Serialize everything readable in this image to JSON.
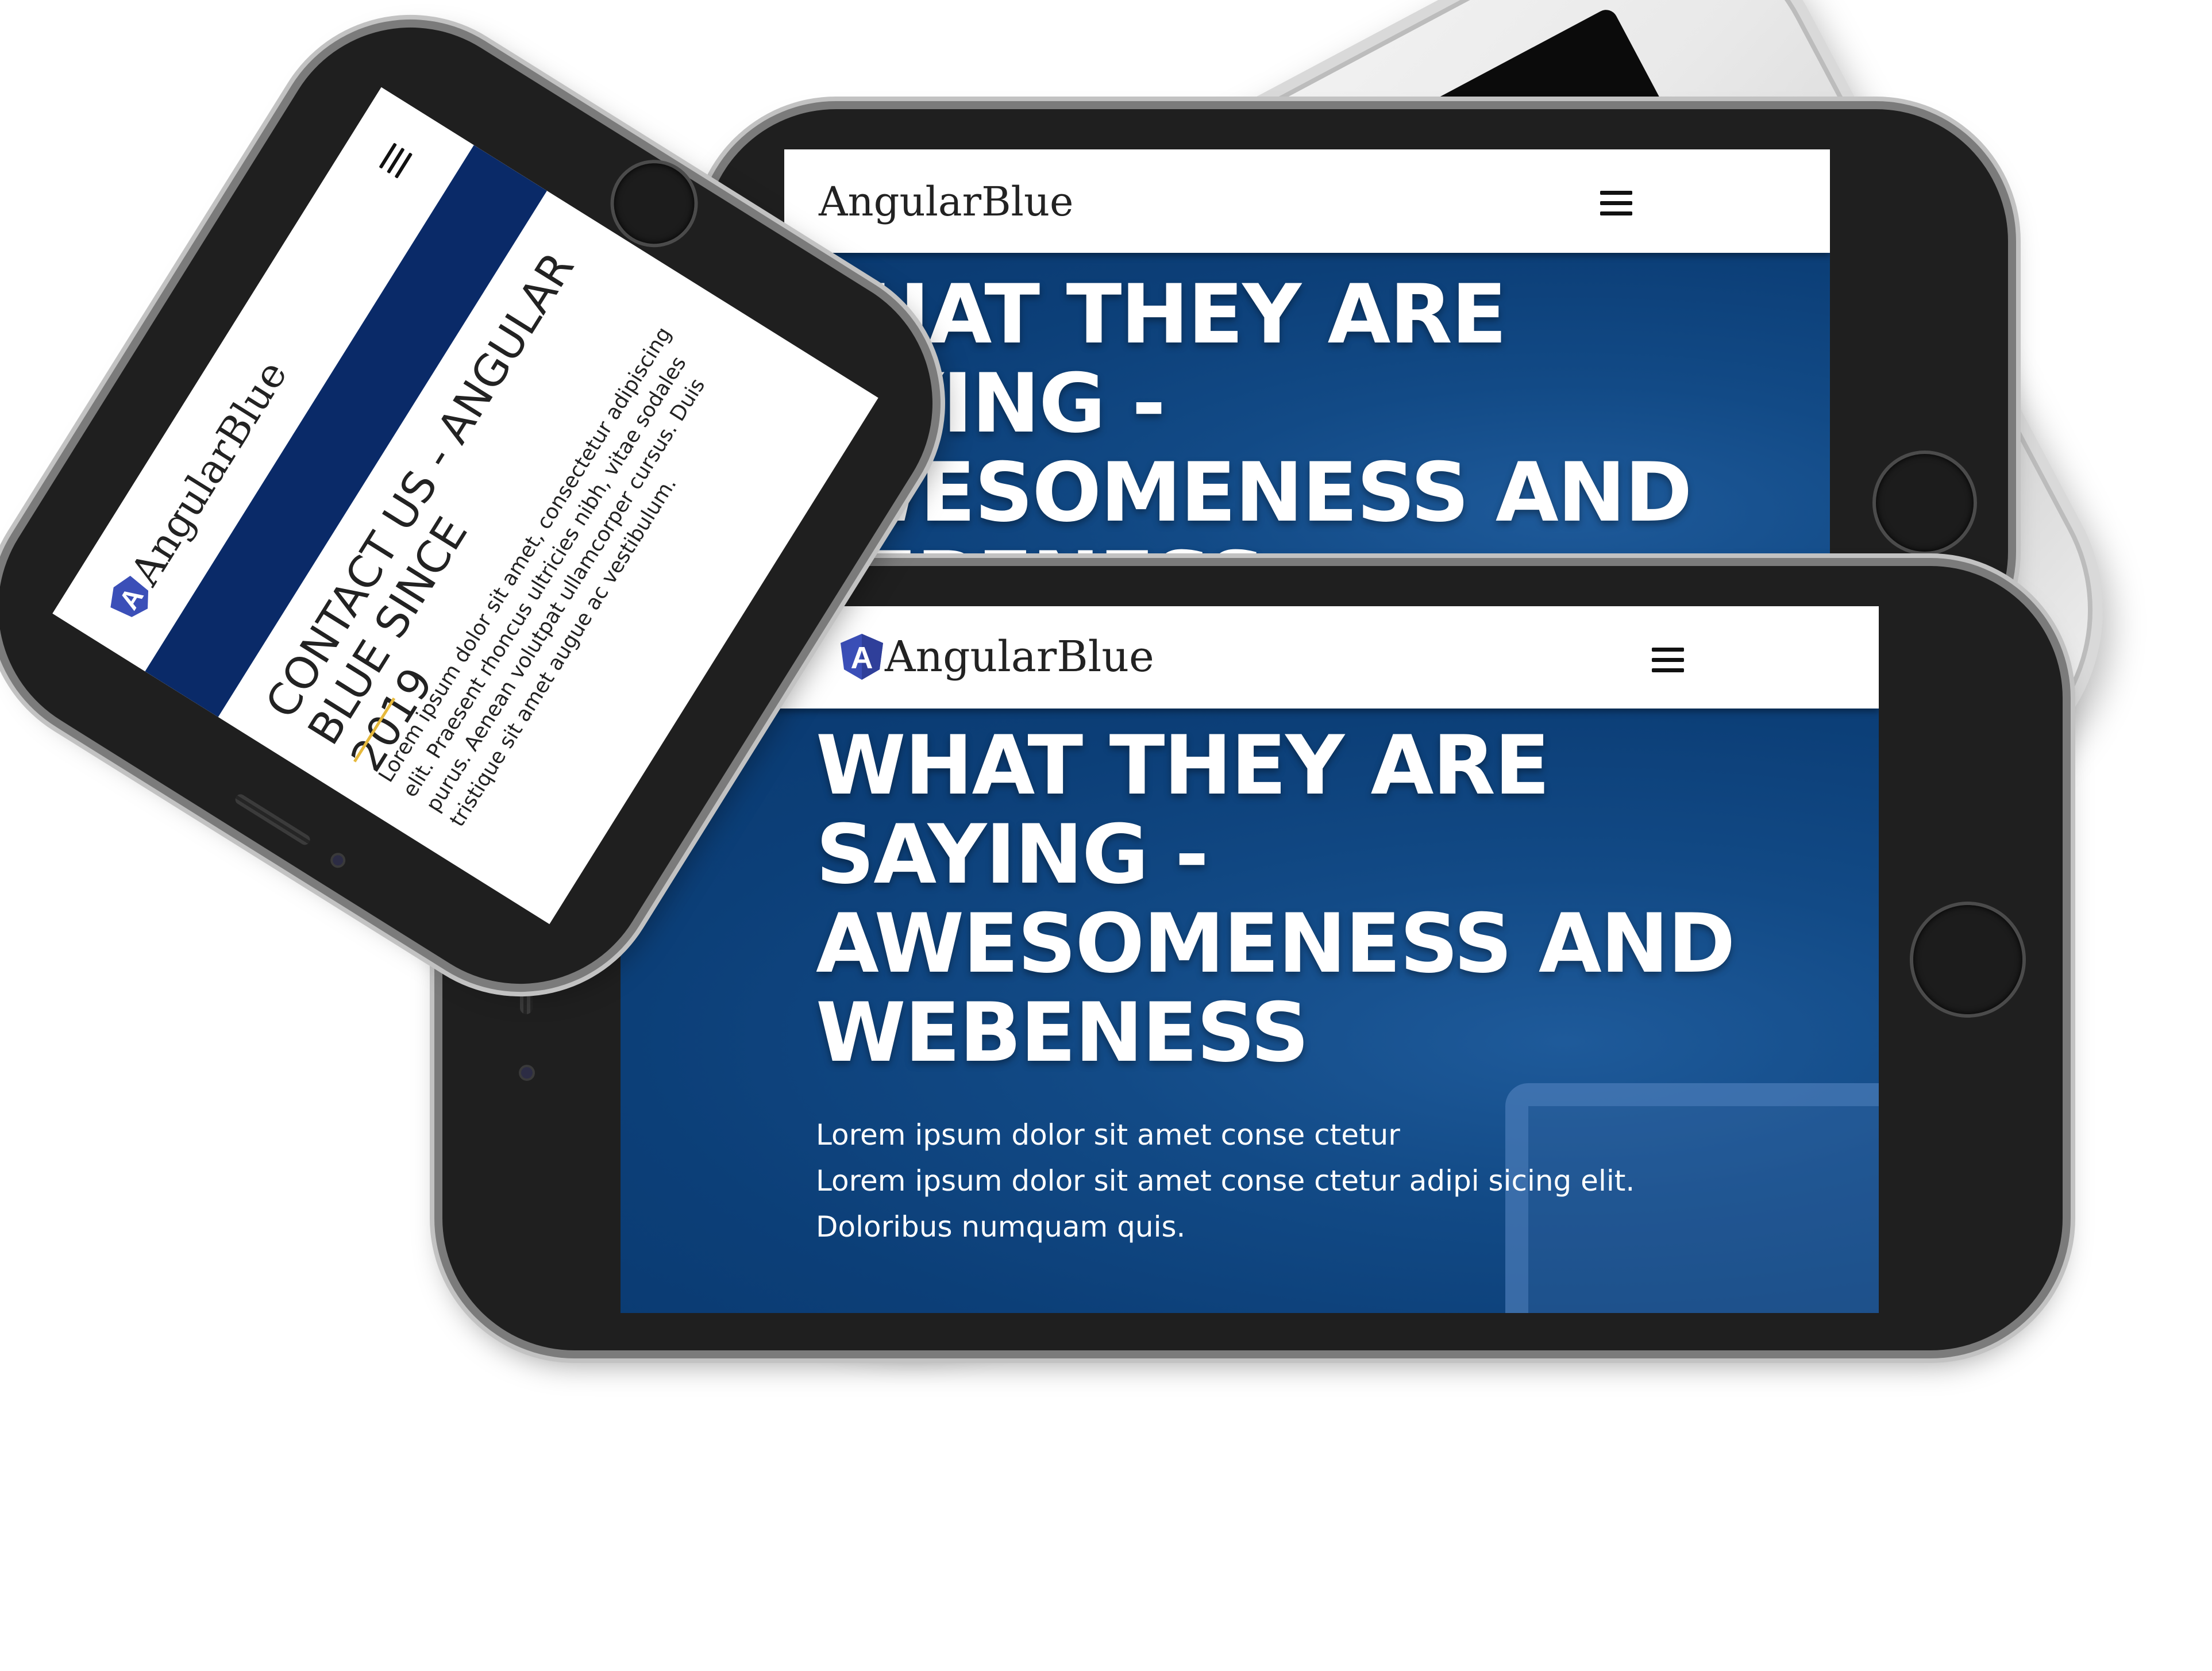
{
  "brand": {
    "name": "AngularBlue",
    "logo_letter": "A"
  },
  "hero": {
    "title_lines": [
      "WHAT THEY ARE",
      "SAYING -",
      "AWESOMENESS AND",
      "WEBENESS"
    ],
    "text_lines": [
      "Lorem ipsum dolor sit amet conse ctetur",
      "Lorem ipsum dolor sit amet conse ctetur adipi sicing elit.",
      "Doloribus numquam quis."
    ]
  },
  "contact": {
    "title_lines": [
      "CONTACT US - ANGULAR BLUE SINCE",
      "2019"
    ],
    "body": "Lorem ipsum dolor sit amet, consectetur adipiscing elit. Praesent rhoncus ultricies nibh, vitae sodales purus. Aenean volutpat ullamcorper cursus. Duis tristique sit amet augue ac vestibulum."
  },
  "colors": {
    "hero_blue": "#0d4079",
    "nav_dark_blue": "#0a2a68",
    "accent_yellow": "#e6b93c",
    "logo_blue": "#3b4fb8"
  },
  "icons": {
    "menu": "hamburger-icon",
    "logo": "angular-shield-icon",
    "home_button": "home-button-icon"
  }
}
